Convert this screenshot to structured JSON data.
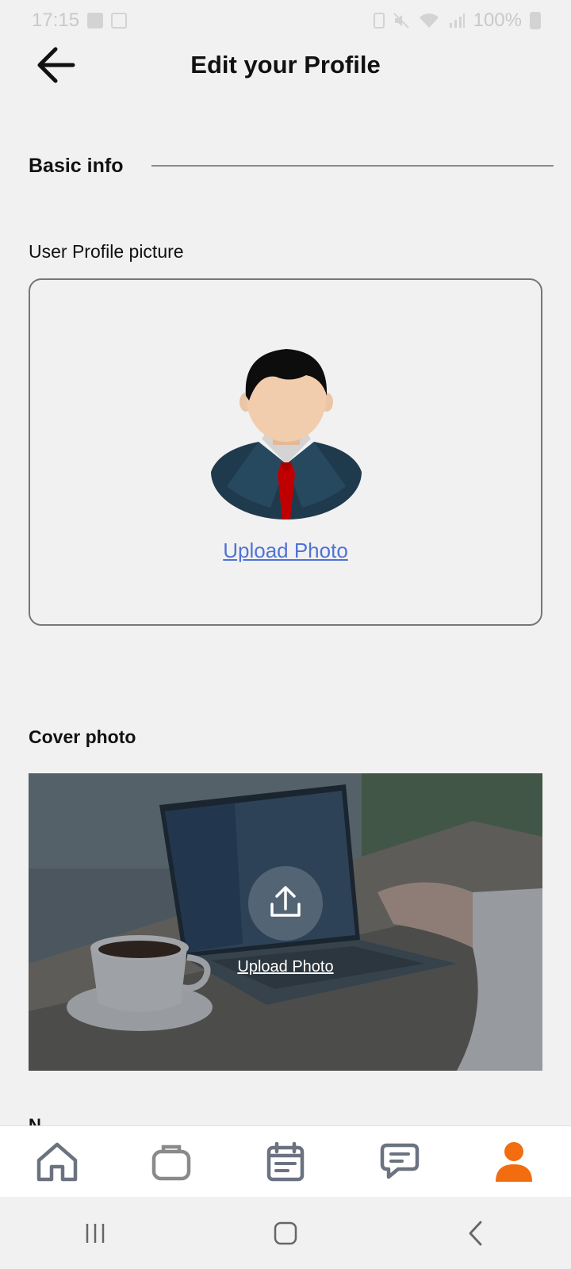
{
  "status_bar": {
    "time": "17:15",
    "battery": "100%"
  },
  "header": {
    "title": "Edit your Profile"
  },
  "basic_info": {
    "heading": "Basic info"
  },
  "profile_picture": {
    "label": "User Profile picture",
    "upload_label": "Upload Photo"
  },
  "cover_photo": {
    "label": "Cover photo",
    "upload_label": "Upload Photo"
  },
  "next_field_peek": "N",
  "bottom_nav": {
    "items": [
      {
        "name": "home",
        "icon": "home-icon",
        "active": false
      },
      {
        "name": "jobs",
        "icon": "briefcase-icon",
        "active": false
      },
      {
        "name": "calendar",
        "icon": "calendar-icon",
        "active": false
      },
      {
        "name": "messages",
        "icon": "chat-icon",
        "active": false
      },
      {
        "name": "profile",
        "icon": "person-icon",
        "active": true
      }
    ]
  },
  "colors": {
    "accent": "#f26c10",
    "link": "#4f73d6",
    "nav_icon": "#6b7280"
  }
}
